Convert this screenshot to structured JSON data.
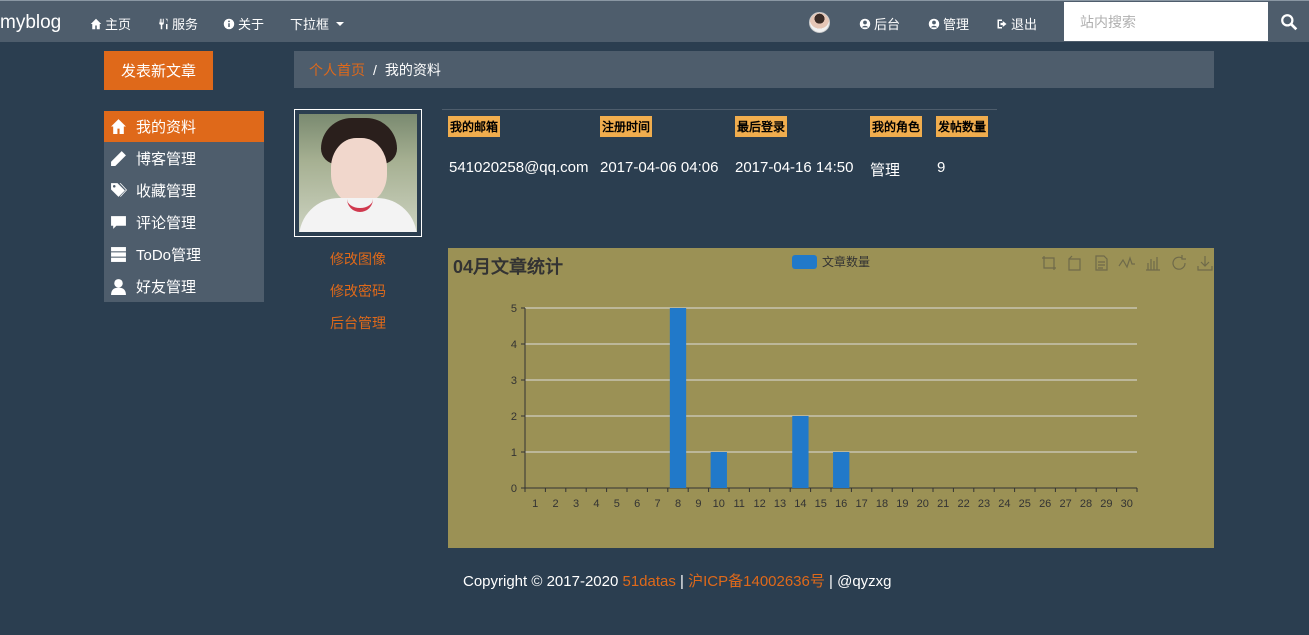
{
  "navbar": {
    "brand": "myblog",
    "items": [
      {
        "label": "主页",
        "icon": "home-icon"
      },
      {
        "label": "服务",
        "icon": "cutlery-icon"
      },
      {
        "label": "关于",
        "icon": "info-icon"
      },
      {
        "label": "下拉框",
        "icon": "caret-down-icon"
      }
    ],
    "right_items": [
      {
        "label": "后台",
        "icon": "user-circle-icon"
      },
      {
        "label": "管理",
        "icon": "user-circle-icon"
      },
      {
        "label": "退出",
        "icon": "logout-icon"
      }
    ],
    "search_placeholder": "站内搜索"
  },
  "new_post_label": "发表新文章",
  "breadcrumb": {
    "home": "个人首页",
    "separator": "/",
    "current": "我的资料"
  },
  "sidebar": {
    "items": [
      {
        "label": "我的资料",
        "icon": "home-icon",
        "active": true
      },
      {
        "label": "博客管理",
        "icon": "pencil-icon"
      },
      {
        "label": "收藏管理",
        "icon": "tags-icon"
      },
      {
        "label": "评论管理",
        "icon": "comment-icon"
      },
      {
        "label": "ToDo管理",
        "icon": "tasks-icon"
      },
      {
        "label": "好友管理",
        "icon": "user-icon"
      }
    ]
  },
  "profile": {
    "links": [
      "修改图像",
      "修改密码",
      "后台管理"
    ]
  },
  "info": {
    "headers": [
      "我的邮箱",
      "注册时间",
      "最后登录",
      "我的角色",
      "发帖数量"
    ],
    "values": [
      "541020258@qq.com",
      "2017-04-06 04:06",
      "2017-04-16 14:50",
      "管理",
      "9"
    ]
  },
  "chart_data": {
    "type": "bar",
    "title": "04月文章统计",
    "legend": [
      "文章数量"
    ],
    "categories": [
      "1",
      "2",
      "3",
      "4",
      "5",
      "6",
      "7",
      "8",
      "9",
      "10",
      "11",
      "12",
      "13",
      "14",
      "15",
      "16",
      "17",
      "18",
      "19",
      "20",
      "21",
      "22",
      "23",
      "24",
      "25",
      "26",
      "27",
      "28",
      "29",
      "30"
    ],
    "series": [
      {
        "name": "文章数量",
        "values": [
          0,
          0,
          0,
          0,
          0,
          0,
          0,
          5,
          0,
          1,
          0,
          0,
          0,
          2,
          0,
          1,
          0,
          0,
          0,
          0,
          0,
          0,
          0,
          0,
          0,
          0,
          0,
          0,
          0,
          0
        ]
      }
    ],
    "ylim": [
      0,
      5
    ],
    "yticks": [
      0,
      1,
      2,
      3,
      4,
      5
    ],
    "grid": true,
    "legend_position": "top-center",
    "bar_color": "#2179c9",
    "background": "#9b9155"
  },
  "footer": {
    "copyright": "Copyright © 2017-2020 ",
    "site": "51datas",
    "sep1": " | ",
    "icp": "沪ICP备14002636号",
    "sep2": " | ",
    "author": "@qyzxg"
  },
  "colors": {
    "accent": "#df691a",
    "nav": "#4e5d6c",
    "bg": "#2b3e50",
    "badge": "#f0ad4e"
  }
}
